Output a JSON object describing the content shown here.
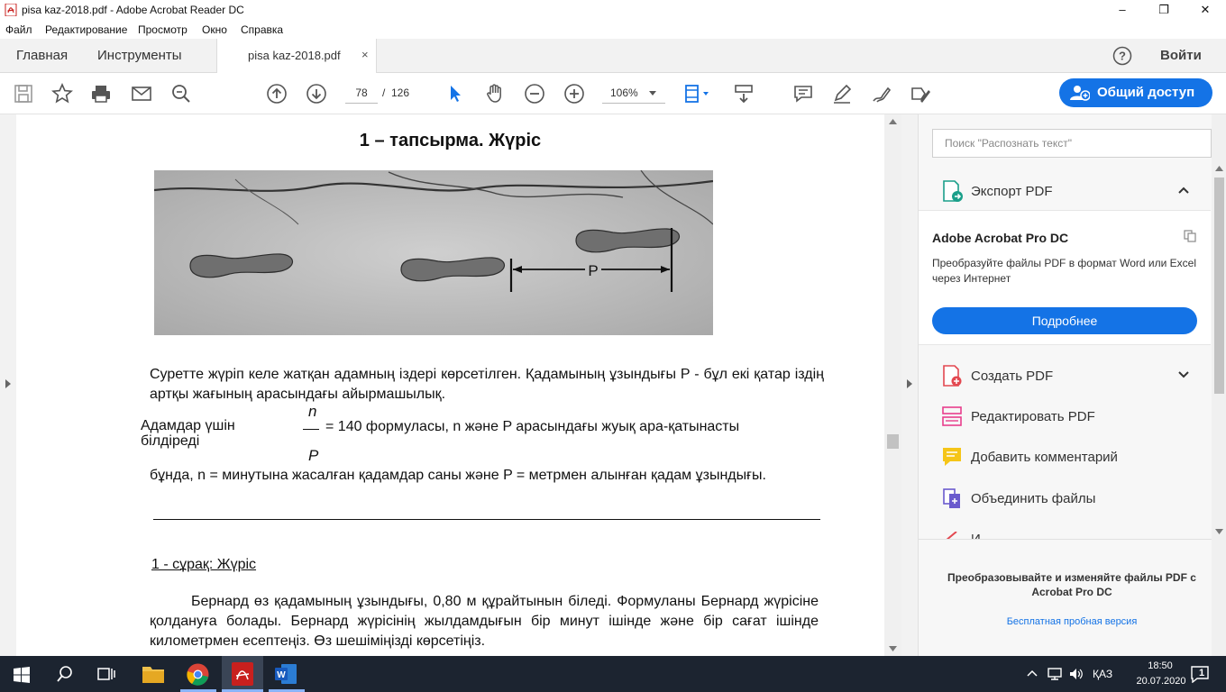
{
  "window": {
    "title": "pisa kaz-2018.pdf - Adobe Acrobat Reader DC",
    "controls": [
      "–",
      "❐",
      "✕"
    ]
  },
  "menu": [
    "Файл",
    "Редактирование",
    "Просмотр",
    "Окно",
    "Справка"
  ],
  "tabs": {
    "home": "Главная",
    "tools": "Инструменты",
    "doc": "pisa kaz-2018.pdf",
    "close": "×",
    "help": "?",
    "signin": "Войти"
  },
  "toolbar": {
    "page_current": "78",
    "page_sep": "/",
    "page_total": "126",
    "zoom": "106%",
    "share": "Общий доступ"
  },
  "document": {
    "heading": "1 – тапсырма. Жүріс",
    "photo_label": "P",
    "para1": "Суретте жүріп келе жатқан адамның іздері көрсетілген. Қадамының ұзындығы P - бұл екі қатар іздің артқы жағының арасындағы айырмашылық.",
    "formula_prefix": "Адамдар үшін",
    "formula_prefix2": "білдіреді",
    "formula_num": "n",
    "formula_den": "P",
    "formula_rest": "= 140 формуласы, n және P арасындағы жуық ара-қатынасты",
    "para2": "бұнда, n = минутына жасалған қадамдар саны және P = метрмен алынған қадам ұзындығы.",
    "question": "1 - сұрақ: Жүріс",
    "para3": "Бернард өз қадамының ұзындығы, 0,80 м құрайтынын біледі. Формуланы Бернард жүрісіне қолдануға болады. Бернард жүрісінің жылдамдығын бір минут ішінде және бір сағат ішінде километрмен есептеңіз. Өз шешіміңізді көрсетіңіз."
  },
  "right_panel": {
    "search_placeholder": "Поиск \"Распознать текст\"",
    "export_pdf": "Экспорт PDF",
    "promo_title": "Adobe Acrobat Pro DC",
    "promo_text": "Преобразуйте файлы PDF в формат Word или Excel через Интернет",
    "promo_button": "Подробнее",
    "tools": [
      "Создать PDF",
      "Редактировать PDF",
      "Добавить комментарий",
      "Объединить файлы",
      "И..."
    ],
    "footer_text": "Преобразовывайте и изменяйте файлы PDF с Acrobat Pro DC",
    "footer_link": "Бесплатная пробная версия"
  },
  "taskbar": {
    "lang": "ҚАЗ",
    "time": "18:50",
    "date": "20.07.2020",
    "notif": "1"
  },
  "colors": {
    "accent": "#1473e6",
    "taskbar": "#1c2430"
  }
}
